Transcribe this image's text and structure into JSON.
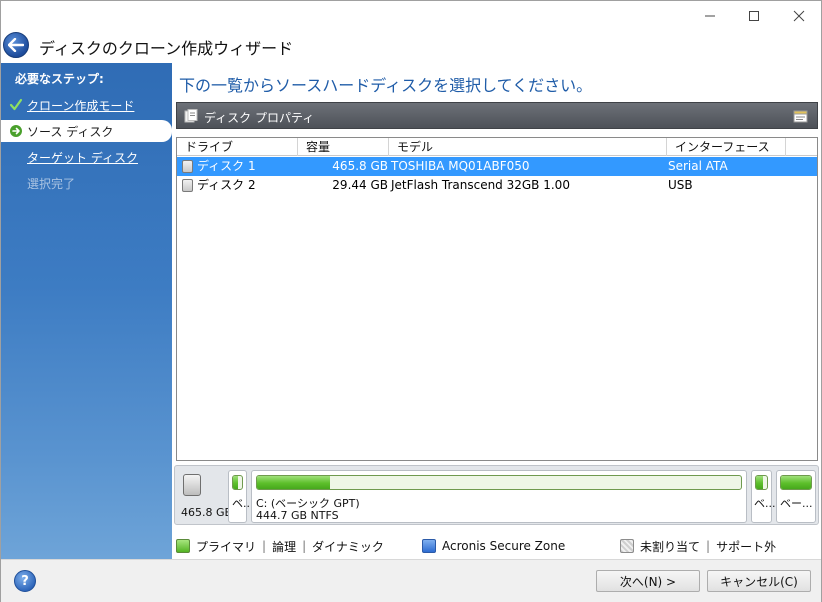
{
  "window": {
    "title": "ディスクのクローン作成ウィザード"
  },
  "sidebar": {
    "heading": "必要なステップ:",
    "items": [
      {
        "label": "クローン作成モード",
        "state": "done"
      },
      {
        "label": "ソース ディスク",
        "state": "active"
      },
      {
        "label": "ターゲット ディスク",
        "state": "next"
      },
      {
        "label": "選択完了",
        "state": "disabled"
      }
    ]
  },
  "main": {
    "heading": "下の一覧からソースハードディスクを選択してください。",
    "properties_label": "ディスク プロパティ"
  },
  "table": {
    "columns": [
      "ドライブ",
      "容量",
      "モデル",
      "インターフェース"
    ],
    "rows": [
      {
        "drive": "ディスク 1",
        "capacity": "465.8 GB",
        "model": "TOSHIBA MQ01ABF050",
        "interface": "Serial ATA",
        "selected": true
      },
      {
        "drive": "ディスク 2",
        "capacity": "29.44 GB",
        "model": "JetFlash Transcend 32GB 1.00",
        "interface": "USB",
        "selected": false
      }
    ]
  },
  "diskmap": {
    "disk_size": "465.8 GB",
    "partitions": [
      {
        "label": "ベ...",
        "used_fraction": 0.6
      },
      {
        "label": "C: (ベーシック GPT)",
        "detail": "444.7 GB  NTFS",
        "used_fraction": 0.15
      },
      {
        "label": "ベ...",
        "used_fraction": 0.6
      },
      {
        "label": "ベー...",
        "used_fraction": 1.0
      }
    ]
  },
  "legend": {
    "primary": "プライマリ",
    "logical": "論理",
    "dynamic": "ダイナミック",
    "secure_zone": "Acronis Secure Zone",
    "unallocated": "未割り当て",
    "unsupported": "サポート外"
  },
  "footer": {
    "help": "?",
    "next_label": "次へ(N) >",
    "cancel_label": "キャンセル(C)"
  },
  "colors": {
    "sidebar": "#3d7cc3",
    "heading": "#1f5ca8",
    "selection": "#3399ff",
    "partition_green": "#5dbf2b"
  }
}
